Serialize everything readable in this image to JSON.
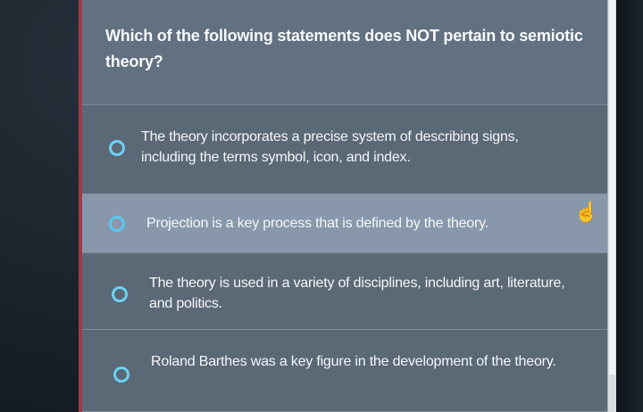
{
  "question": {
    "text": "Which of the following statements does NOT pertain to semiotic theory?"
  },
  "options": [
    {
      "label": "The theory incorporates a precise system of describing signs, including the terms symbol, icon, and index."
    },
    {
      "label": "Projection is a key process that is defined by the theory."
    },
    {
      "label": "The theory is used in a variety of disciplines, including art, literature, and politics."
    },
    {
      "label": "Roland Barthes was a key figure in the development of the theory."
    }
  ],
  "icons": {
    "radio": "radio-button-icon",
    "cursor": "hand-pointer-icon"
  },
  "colors": {
    "panel": "#5c6774",
    "question_panel": "#627080",
    "selected_row": "#8898aa",
    "radio_outline": "#6bd3f5",
    "accent_border": "#a13a4b"
  }
}
